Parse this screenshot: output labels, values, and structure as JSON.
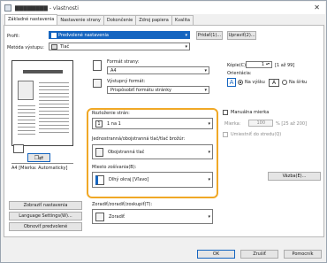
{
  "window": {
    "title": "▇▇▇▇▇▇▇▇ - vlastnosti",
    "close": "✕"
  },
  "tabs": [
    "Základné nastavenia",
    "Nastavenie strany",
    "Dokončenie",
    "Zdroj papiera",
    "Kvalita"
  ],
  "profile": {
    "label": "Profil:",
    "value": "Predvolené nastavenia",
    "add": "Pridať(1)...",
    "edit": "Upraviť(2)..."
  },
  "output_method": {
    "label": "Metóda výstupu:",
    "value": "Tlač"
  },
  "page_size": {
    "label": "Formát strany:",
    "value": "A4"
  },
  "output_size": {
    "label": "Výstupný formát:",
    "value": "Prispôsobiť formátu stránky"
  },
  "copies": {
    "label": "Kópie(C):",
    "value": "1",
    "range": "[1 až 99]"
  },
  "orientation": {
    "label": "Orientácia:",
    "portrait": "Na výšku",
    "landscape": "Na šírku",
    "portrait_icon": "A",
    "landscape_icon": "A"
  },
  "layout": {
    "label": "Rozloženie strán:",
    "value": "1 na 1"
  },
  "manual_scale": {
    "label": "Manuálna mierka",
    "scale_label": "Mierka:",
    "scale_value": "100",
    "scale_range": "% [25 až 200]"
  },
  "watermark_label": "Umiestniť do stredu(Q)",
  "duplex": {
    "label": "Jednostranná/obojstranná tlač/tlač brožúr:",
    "value": "Obojstranná tlač"
  },
  "binding": {
    "label": "Miesto zošívania(B):",
    "value": "Dlhý okraj [Vľavo]"
  },
  "binding_btn": "Väzba(E)...",
  "collate": {
    "label": "Zoradiť/zoradiť/zoskupiť(T):",
    "value": "Zoradiť"
  },
  "preview": {
    "caption": "A4 [Mierka: Automaticky]"
  },
  "side_buttons": [
    "Zobraziť nastavenia",
    "Language Settings(W)...",
    "Obnoviť predvolené"
  ],
  "footer": {
    "ok": "OK",
    "cancel": "Zrušiť",
    "help": "Pomocník"
  },
  "accent": "#f0a826"
}
